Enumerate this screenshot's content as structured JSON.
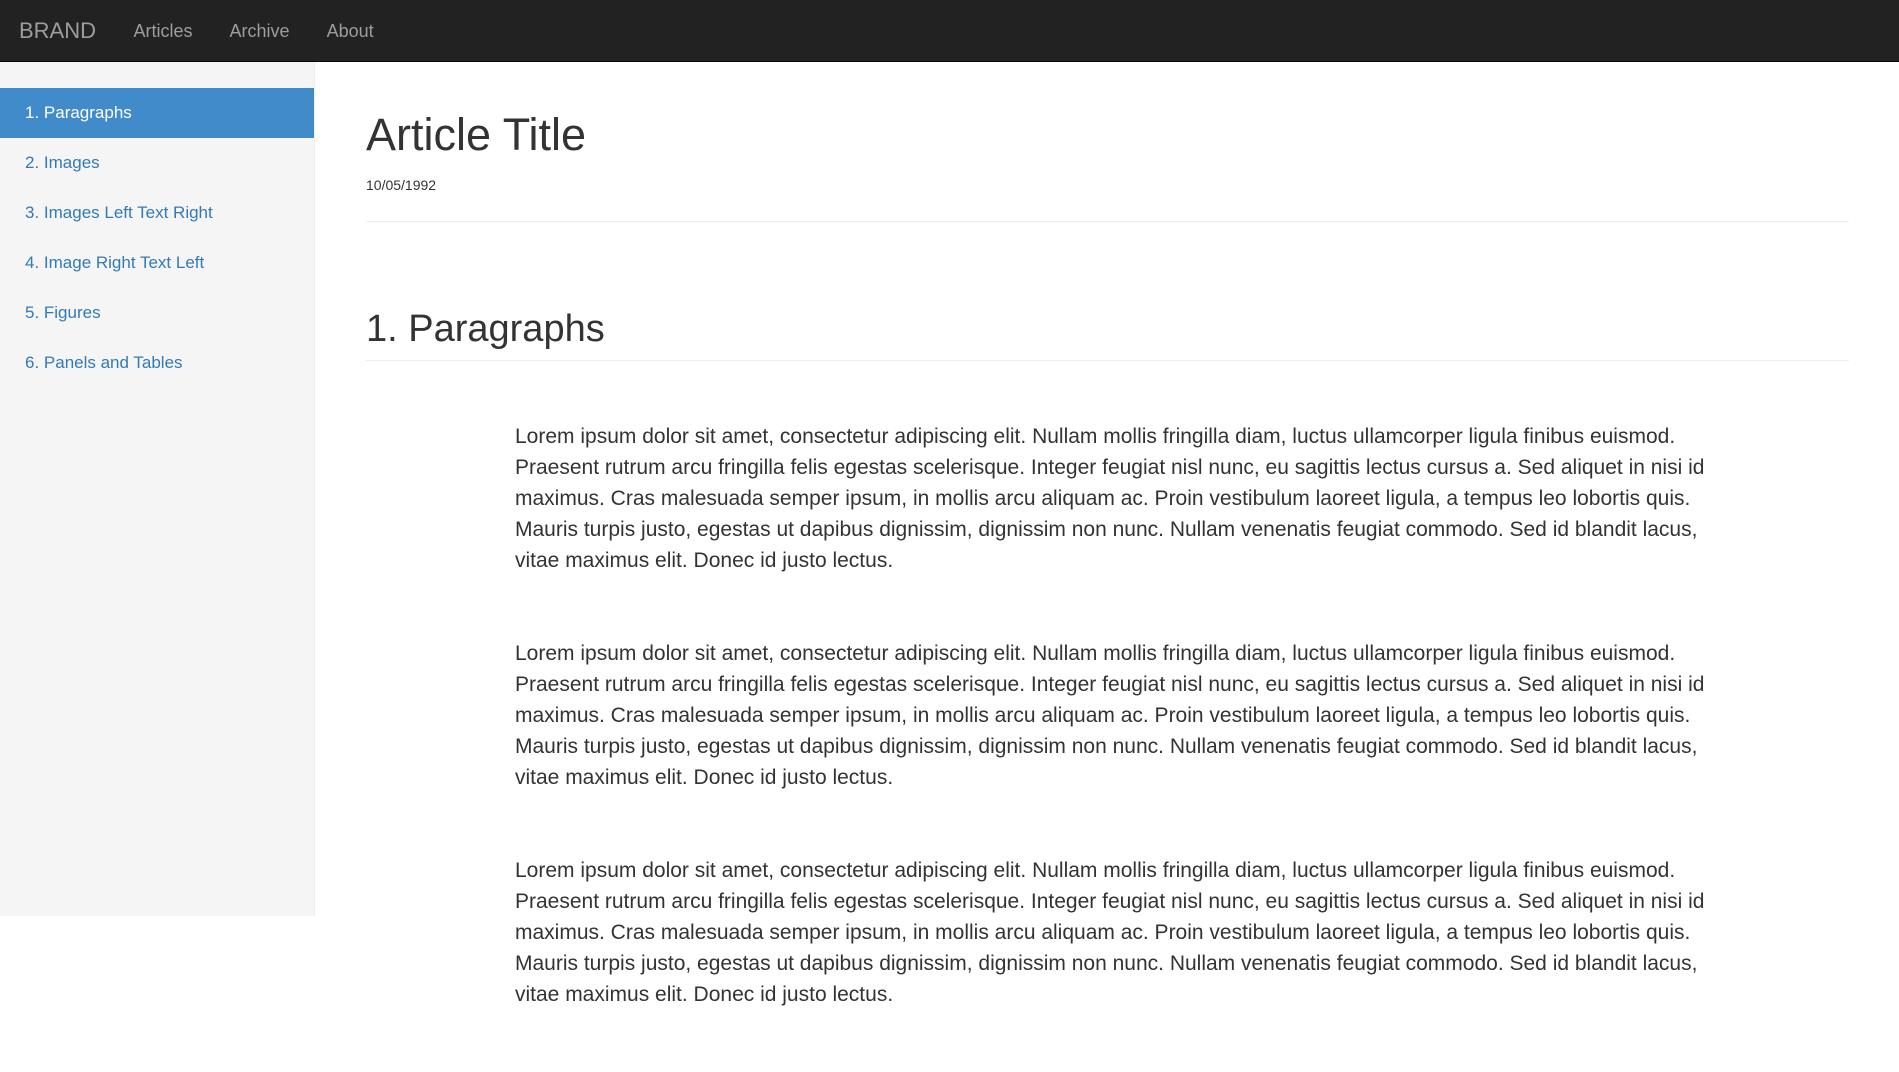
{
  "navbar": {
    "brand": "BRAND",
    "links": [
      {
        "label": "Articles"
      },
      {
        "label": "Archive"
      },
      {
        "label": "About"
      }
    ]
  },
  "sidebar": {
    "items": [
      {
        "label": "1. Paragraphs",
        "active": true
      },
      {
        "label": "2. Images",
        "active": false
      },
      {
        "label": "3. Images Left Text Right",
        "active": false
      },
      {
        "label": "4. Image Right Text Left",
        "active": false
      },
      {
        "label": "5. Figures",
        "active": false
      },
      {
        "label": "6. Panels and Tables",
        "active": false
      }
    ]
  },
  "article": {
    "title": "Article Title",
    "date": "10/05/1992",
    "section_title": "1. Paragraphs",
    "paragraphs": [
      "Lorem ipsum dolor sit amet, consectetur adipiscing elit. Nullam mollis fringilla diam, luctus ullamcorper ligula finibus euismod. Praesent rutrum arcu fringilla felis egestas scelerisque. Integer feugiat nisl nunc, eu sagittis lectus cursus a. Sed aliquet in nisi id maximus. Cras malesuada semper ipsum, in mollis arcu aliquam ac. Proin vestibulum laoreet ligula, a tempus leo lobortis quis. Mauris turpis justo, egestas ut dapibus dignissim, dignissim non nunc. Nullam venenatis feugiat commodo. Sed id blandit lacus, vitae maximus elit. Donec id justo lectus.",
      "Lorem ipsum dolor sit amet, consectetur adipiscing elit. Nullam mollis fringilla diam, luctus ullamcorper ligula finibus euismod. Praesent rutrum arcu fringilla felis egestas scelerisque. Integer feugiat nisl nunc, eu sagittis lectus cursus a. Sed aliquet in nisi id maximus. Cras malesuada semper ipsum, in mollis arcu aliquam ac. Proin vestibulum laoreet ligula, a tempus leo lobortis quis. Mauris turpis justo, egestas ut dapibus dignissim, dignissim non nunc. Nullam venenatis feugiat commodo. Sed id blandit lacus, vitae maximus elit. Donec id justo lectus.",
      "Lorem ipsum dolor sit amet, consectetur adipiscing elit. Nullam mollis fringilla diam, luctus ullamcorper ligula finibus euismod. Praesent rutrum arcu fringilla felis egestas scelerisque. Integer feugiat nisl nunc, eu sagittis lectus cursus a. Sed aliquet in nisi id maximus. Cras malesuada semper ipsum, in mollis arcu aliquam ac. Proin vestibulum laoreet ligula, a tempus leo lobortis quis. Mauris turpis justo, egestas ut dapibus dignissim, dignissim non nunc. Nullam venenatis feugiat commodo. Sed id blandit lacus, vitae maximus elit. Donec id justo lectus."
    ]
  },
  "colors": {
    "navbar_bg": "#222222",
    "nav_text": "#9d9d9d",
    "sidebar_bg": "#f5f5f5",
    "active_bg": "#428bca",
    "link": "#337ab7",
    "text": "#333333"
  }
}
